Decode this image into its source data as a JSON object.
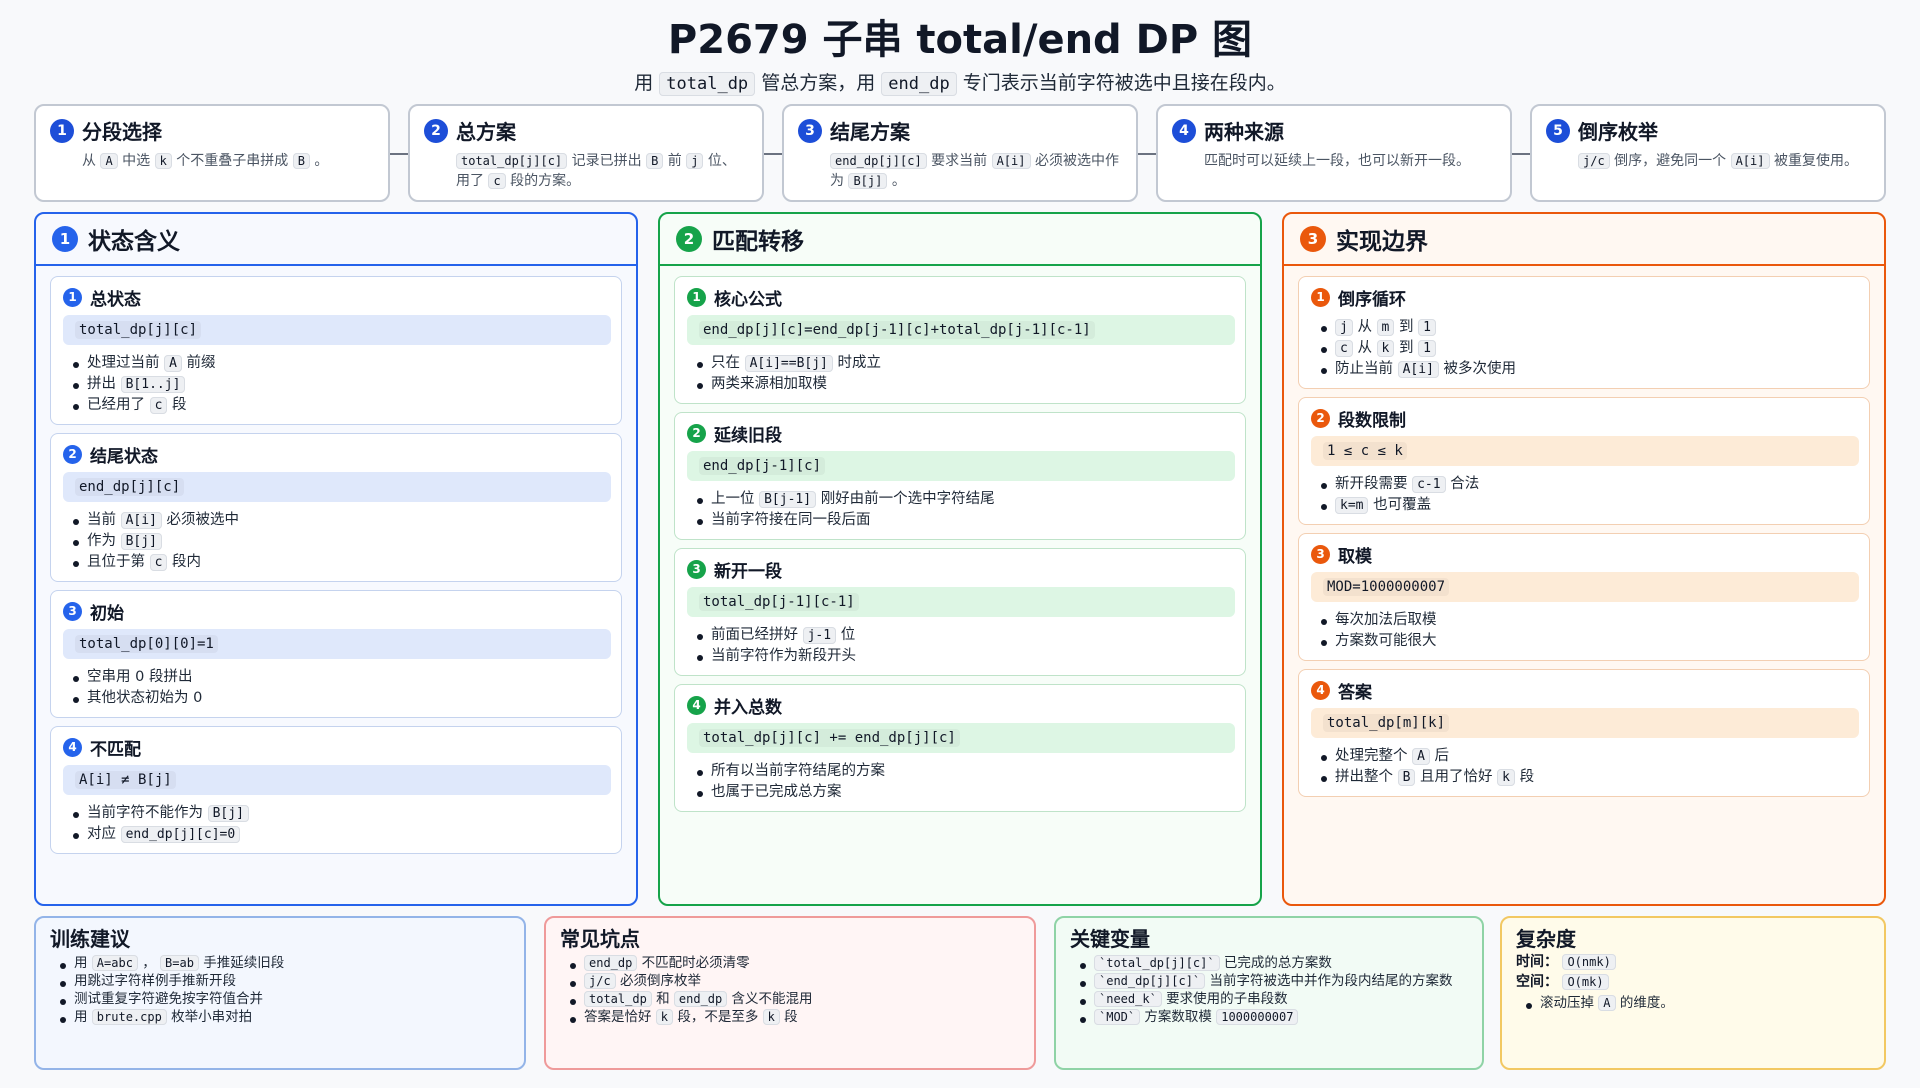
{
  "header": {
    "title": "P2679 子串 total/end DP 图",
    "subtitle": {
      "p1": "用",
      "c1": "total_dp",
      "p2": "管总方案，用",
      "c2": "end_dp",
      "p3": "专门表示当前字符被选中且接在段内。"
    }
  },
  "steps": [
    {
      "num": "1",
      "title": "分段选择",
      "desc": [
        [
          "t",
          "从"
        ],
        [
          "c",
          "A"
        ],
        [
          "t",
          "中选"
        ],
        [
          "c",
          "k"
        ],
        [
          "t",
          "个不重叠子串拼成"
        ],
        [
          "c",
          "B"
        ],
        [
          "t",
          "。"
        ]
      ]
    },
    {
      "num": "2",
      "title": "总方案",
      "desc": [
        [
          "c",
          "total_dp[j][c]"
        ],
        [
          "t",
          "记录已拼出"
        ],
        [
          "c",
          "B"
        ],
        [
          "t",
          "前"
        ],
        [
          "c",
          "j"
        ],
        [
          "t",
          "位、用了"
        ],
        [
          "c",
          "c"
        ],
        [
          "t",
          "段的方案。"
        ]
      ]
    },
    {
      "num": "3",
      "title": "结尾方案",
      "desc": [
        [
          "c",
          "end_dp[j][c]"
        ],
        [
          "t",
          "要求当前"
        ],
        [
          "c",
          "A[i]"
        ],
        [
          "t",
          "必须被选中作为"
        ],
        [
          "c",
          "B[j]"
        ],
        [
          "t",
          "。"
        ]
      ]
    },
    {
      "num": "4",
      "title": "两种来源",
      "desc": [
        [
          "t",
          "匹配时可以延续上一段，也可以新开一段。"
        ]
      ]
    },
    {
      "num": "5",
      "title": "倒序枚举",
      "desc": [
        [
          "c",
          "j/c"
        ],
        [
          "t",
          "倒序，避免同一个"
        ],
        [
          "c",
          "A[i]"
        ],
        [
          "t",
          "被重复使用。"
        ]
      ]
    }
  ],
  "columns": [
    {
      "num": "1",
      "title": "状态含义",
      "color": "blue",
      "cards": [
        {
          "num": "1",
          "title": "总状态",
          "formula": "total_dp[j][c]",
          "bullets": [
            [
              [
                "t",
                "处理过当前"
              ],
              [
                "c",
                "A"
              ],
              [
                "t",
                "前缀"
              ]
            ],
            [
              [
                "t",
                "拼出"
              ],
              [
                "c",
                "B[1..j]"
              ]
            ],
            [
              [
                "t",
                "已经用了"
              ],
              [
                "c",
                "c"
              ],
              [
                "t",
                "段"
              ]
            ]
          ]
        },
        {
          "num": "2",
          "title": "结尾状态",
          "formula": "end_dp[j][c]",
          "bullets": [
            [
              [
                "t",
                "当前"
              ],
              [
                "c",
                "A[i]"
              ],
              [
                "t",
                "必须被选中"
              ]
            ],
            [
              [
                "t",
                "作为"
              ],
              [
                "c",
                "B[j]"
              ]
            ],
            [
              [
                "t",
                "且位于第"
              ],
              [
                "c",
                "c"
              ],
              [
                "t",
                "段内"
              ]
            ]
          ]
        },
        {
          "num": "3",
          "title": "初始",
          "formula": "total_dp[0][0]=1",
          "bullets": [
            [
              [
                "t",
                "空串用 0 段拼出"
              ]
            ],
            [
              [
                "t",
                "其他状态初始为 0"
              ]
            ]
          ]
        },
        {
          "num": "4",
          "title": "不匹配",
          "formula": "A[i] ≠ B[j]",
          "bullets": [
            [
              [
                "t",
                "当前字符不能作为"
              ],
              [
                "c",
                "B[j]"
              ]
            ],
            [
              [
                "t",
                "对应"
              ],
              [
                "c",
                "end_dp[j][c]=0"
              ]
            ]
          ]
        }
      ]
    },
    {
      "num": "2",
      "title": "匹配转移",
      "color": "green",
      "cards": [
        {
          "num": "1",
          "title": "核心公式",
          "formula": "end_dp[j][c]=end_dp[j-1][c]+total_dp[j-1][c-1]",
          "bullets": [
            [
              [
                "t",
                "只在"
              ],
              [
                "c",
                "A[i]==B[j]"
              ],
              [
                "t",
                "时成立"
              ]
            ],
            [
              [
                "t",
                "两类来源相加取模"
              ]
            ]
          ]
        },
        {
          "num": "2",
          "title": "延续旧段",
          "formula": "end_dp[j-1][c]",
          "bullets": [
            [
              [
                "t",
                "上一位"
              ],
              [
                "c",
                "B[j-1]"
              ],
              [
                "t",
                "刚好由前一个选中字符结尾"
              ]
            ],
            [
              [
                "t",
                "当前字符接在同一段后面"
              ]
            ]
          ]
        },
        {
          "num": "3",
          "title": "新开一段",
          "formula": "total_dp[j-1][c-1]",
          "bullets": [
            [
              [
                "t",
                "前面已经拼好"
              ],
              [
                "c",
                "j-1"
              ],
              [
                "t",
                "位"
              ]
            ],
            [
              [
                "t",
                "当前字符作为新段开头"
              ]
            ]
          ]
        },
        {
          "num": "4",
          "title": "并入总数",
          "formula": "total_dp[j][c] += end_dp[j][c]",
          "bullets": [
            [
              [
                "t",
                "所有以当前字符结尾的方案"
              ]
            ],
            [
              [
                "t",
                "也属于已完成总方案"
              ]
            ]
          ]
        }
      ]
    },
    {
      "num": "3",
      "title": "实现边界",
      "color": "orange",
      "cards": [
        {
          "num": "1",
          "title": "倒序循环",
          "formula": "",
          "bullets": [
            [
              [
                "c",
                "j"
              ],
              [
                "t",
                "从"
              ],
              [
                "c",
                "m"
              ],
              [
                "t",
                "到"
              ],
              [
                "c",
                "1"
              ]
            ],
            [
              [
                "c",
                "c"
              ],
              [
                "t",
                "从"
              ],
              [
                "c",
                "k"
              ],
              [
                "t",
                "到"
              ],
              [
                "c",
                "1"
              ]
            ],
            [
              [
                "t",
                "防止当前"
              ],
              [
                "c",
                "A[i]"
              ],
              [
                "t",
                "被多次使用"
              ]
            ]
          ]
        },
        {
          "num": "2",
          "title": "段数限制",
          "formula": "1 ≤ c ≤ k",
          "bullets": [
            [
              [
                "t",
                "新开段需要"
              ],
              [
                "c",
                "c-1"
              ],
              [
                "t",
                "合法"
              ]
            ],
            [
              [
                "c",
                "k=m"
              ],
              [
                "t",
                "也可覆盖"
              ]
            ]
          ]
        },
        {
          "num": "3",
          "title": "取模",
          "formula": "MOD=1000000007",
          "bullets": [
            [
              [
                "t",
                "每次加法后取模"
              ]
            ],
            [
              [
                "t",
                "方案数可能很大"
              ]
            ]
          ]
        },
        {
          "num": "4",
          "title": "答案",
          "formula": "total_dp[m][k]",
          "bullets": [
            [
              [
                "t",
                "处理完整个"
              ],
              [
                "c",
                "A"
              ],
              [
                "t",
                "后"
              ]
            ],
            [
              [
                "t",
                "拼出整个"
              ],
              [
                "c",
                "B"
              ],
              [
                "t",
                "且用了恰好"
              ],
              [
                "c",
                "k"
              ],
              [
                "t",
                "段"
              ]
            ]
          ]
        }
      ]
    }
  ],
  "bottom": {
    "training": {
      "title": "训练建议",
      "bullets": [
        [
          [
            "t",
            "用"
          ],
          [
            "c",
            "A=abc"
          ],
          [
            "t",
            "，"
          ],
          [
            "c",
            "B=ab"
          ],
          [
            "t",
            "手推延续旧段"
          ]
        ],
        [
          [
            "t",
            "用跳过字符样例手推新开段"
          ]
        ],
        [
          [
            "t",
            "测试重复字符避免按字符值合并"
          ]
        ],
        [
          [
            "t",
            "用"
          ],
          [
            "c",
            "brute.cpp"
          ],
          [
            "t",
            "枚举小串对拍"
          ]
        ]
      ]
    },
    "pitfalls": {
      "title": "常见坑点",
      "bullets": [
        [
          [
            "c",
            "end_dp"
          ],
          [
            "t",
            "不匹配时必须清零"
          ]
        ],
        [
          [
            "c",
            "j/c"
          ],
          [
            "t",
            "必须倒序枚举"
          ]
        ],
        [
          [
            "c",
            "total_dp"
          ],
          [
            "t",
            "和"
          ],
          [
            "c",
            "end_dp"
          ],
          [
            "t",
            "含义不能混用"
          ]
        ],
        [
          [
            "t",
            "答案是恰好"
          ],
          [
            "c",
            "k"
          ],
          [
            "t",
            "段，不是至多"
          ],
          [
            "c",
            "k"
          ],
          [
            "t",
            "段"
          ]
        ]
      ]
    },
    "variables": {
      "title": "关键变量",
      "bullets": [
        [
          [
            "c",
            "`total_dp[j][c]`"
          ],
          [
            "t",
            "已完成的总方案数"
          ]
        ],
        [
          [
            "c",
            "`end_dp[j][c]`"
          ],
          [
            "t",
            "当前字符被选中并作为段内结尾的方案数"
          ]
        ],
        [
          [
            "c",
            "`need_k`"
          ],
          [
            "t",
            "要求使用的子串段数"
          ]
        ],
        [
          [
            "c",
            "`MOD`"
          ],
          [
            "t",
            "方案数取模"
          ],
          [
            "c",
            "1000000007"
          ]
        ]
      ]
    },
    "complexity": {
      "title": "复杂度",
      "time_label": "时间：",
      "time_value": "O(nmk)",
      "space_label": "空间：",
      "space_value": "O(mk)",
      "bullets": [
        [
          [
            "t",
            "滚动压掉"
          ],
          [
            "c",
            "A"
          ],
          [
            "t",
            "的维度。"
          ]
        ]
      ]
    }
  }
}
